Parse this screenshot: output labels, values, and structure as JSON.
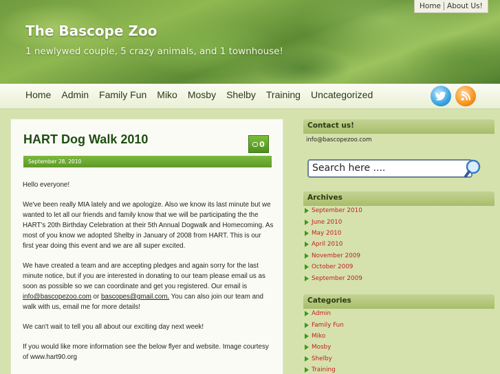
{
  "site": {
    "title": "The Bascope Zoo",
    "description": "1 newlywed couple, 5 crazy animals, and 1 townhouse!"
  },
  "top_links": [
    "Home",
    "About Us!"
  ],
  "nav": [
    "Home",
    "Admin",
    "Family Fun",
    "Miko",
    "Mosby",
    "Shelby",
    "Training",
    "Uncategorized"
  ],
  "social": {
    "twitter_icon": "twitter-icon",
    "rss_icon": "rss-icon"
  },
  "post": {
    "title": "HART Dog Walk 2010",
    "comment_count": "0",
    "date": "September 28, 2010",
    "p1": "Hello everyone!",
    "p2": "We've been really MIA lately and we apologize. Also we know its last minute but we wanted to let all our friends and family know that we will be participating the the HART's 20th Birthday Celebration at their 5th Annual Dogwalk and Homecoming. As most of you know we adopted Shelby in January of 2008 from HART. This is our first year doing this event and we are all super excited.",
    "p3_a": "We have created a team and are accepting pledges and again sorry for the last minute notice, but if you are interested in donating to our team please email us as soon as possible so we can coordinate and get you registered. Our email is ",
    "p3_link1": "info@bascopezoo.com",
    "p3_b": " or ",
    "p3_link2": "bascopes@gmail.com.",
    "p3_c": " You can also join our team and walk with us, email me for more details!",
    "p4": "We can't wait to tell you all about our exciting day next week!",
    "p5": "If you would like more information see the below flyer and website. Image courtesy of www.hart90.org"
  },
  "sidebar": {
    "contact": {
      "heading": "Contact us!",
      "email": "info@bascopezoo.com"
    },
    "search": {
      "placeholder": "Search here ...."
    },
    "archives": {
      "heading": "Archives",
      "items": [
        "September 2010",
        "June 2010",
        "May 2010",
        "April 2010",
        "November 2009",
        "October 2009",
        "September 2009"
      ]
    },
    "categories": {
      "heading": "Categories",
      "items": [
        "Admin",
        "Family Fun",
        "Miko",
        "Mosby",
        "Shelby",
        "Training"
      ]
    }
  },
  "colors": {
    "accent_green": "#5c9a25",
    "link_red": "#c02020",
    "title_green": "#1e4d12"
  }
}
